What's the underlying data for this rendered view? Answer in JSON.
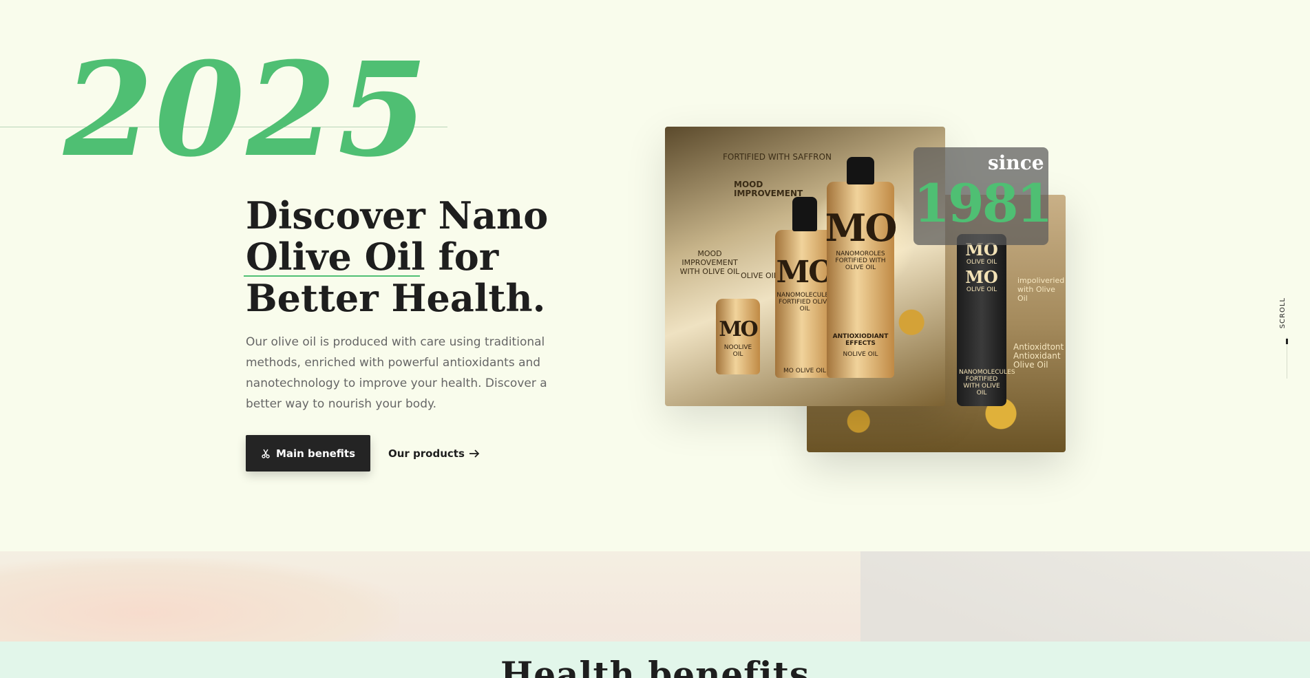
{
  "hero": {
    "year": "2025",
    "headline_line1": "Discover Nano",
    "headline_line2_highlight": "Olive Oil",
    "headline_line2_rest": " for",
    "headline_line3": "Better Health.",
    "description": "Our olive oil is produced with care using traditional methods, enriched with powerful antioxidants and nanotechnology to improve your health. Discover a better way to nourish your body.",
    "primary_button": "Main benefits",
    "primary_button_icon": "scissors-icon",
    "secondary_link": "Our products",
    "secondary_link_icon": "arrow-right-icon"
  },
  "product_image": {
    "top_label": "FORTIFIED WITH SAFFRON",
    "label_mood": "MOOD IMPROVEMENT",
    "label_mood_olive": "MOOD IMPROVEMENT WITH OLIVE OIL",
    "label_olive": "OLIVE OIL",
    "bottle_small_mark": "MO",
    "bottle_small_sub": "NOOLIVE OIL",
    "bottle_drop_mark": "MO",
    "bottle_drop_sub": "NANOMOLECULES FORTIFIED OLIVE OIL",
    "bottle_drop_foot": "MO OLIVE OIL",
    "bottle_big_mark": "MO",
    "bottle_big_sub": "NANOMOROLES FORTIFIED WITH OLIVE OIL",
    "bottle_big_foot": "ANTIOXIODIANT EFFECTS",
    "bottle_big_foot2": "NOLIVE OIL"
  },
  "back_image": {
    "dark_mark_1": "MO",
    "dark_sub_1": "OLIVE OIL",
    "dark_mark_2": "MO",
    "dark_sub_2": "OLIVE OIL",
    "dark_foot": "NANOMOLECULES FORTIFIED WITH OLIVE OIL",
    "side_label_1": "impoliveried with Olive Oil",
    "side_label_2": "Antioxidtont Antioxidant Olive Oil"
  },
  "since_badge": {
    "label": "since",
    "year": "1981"
  },
  "scroll_label": "SCROLL",
  "next_section": {
    "title": "Health benefits"
  },
  "colors": {
    "background": "#f9fcec",
    "accent_green": "#4fbf73",
    "dark_button": "#242424"
  }
}
